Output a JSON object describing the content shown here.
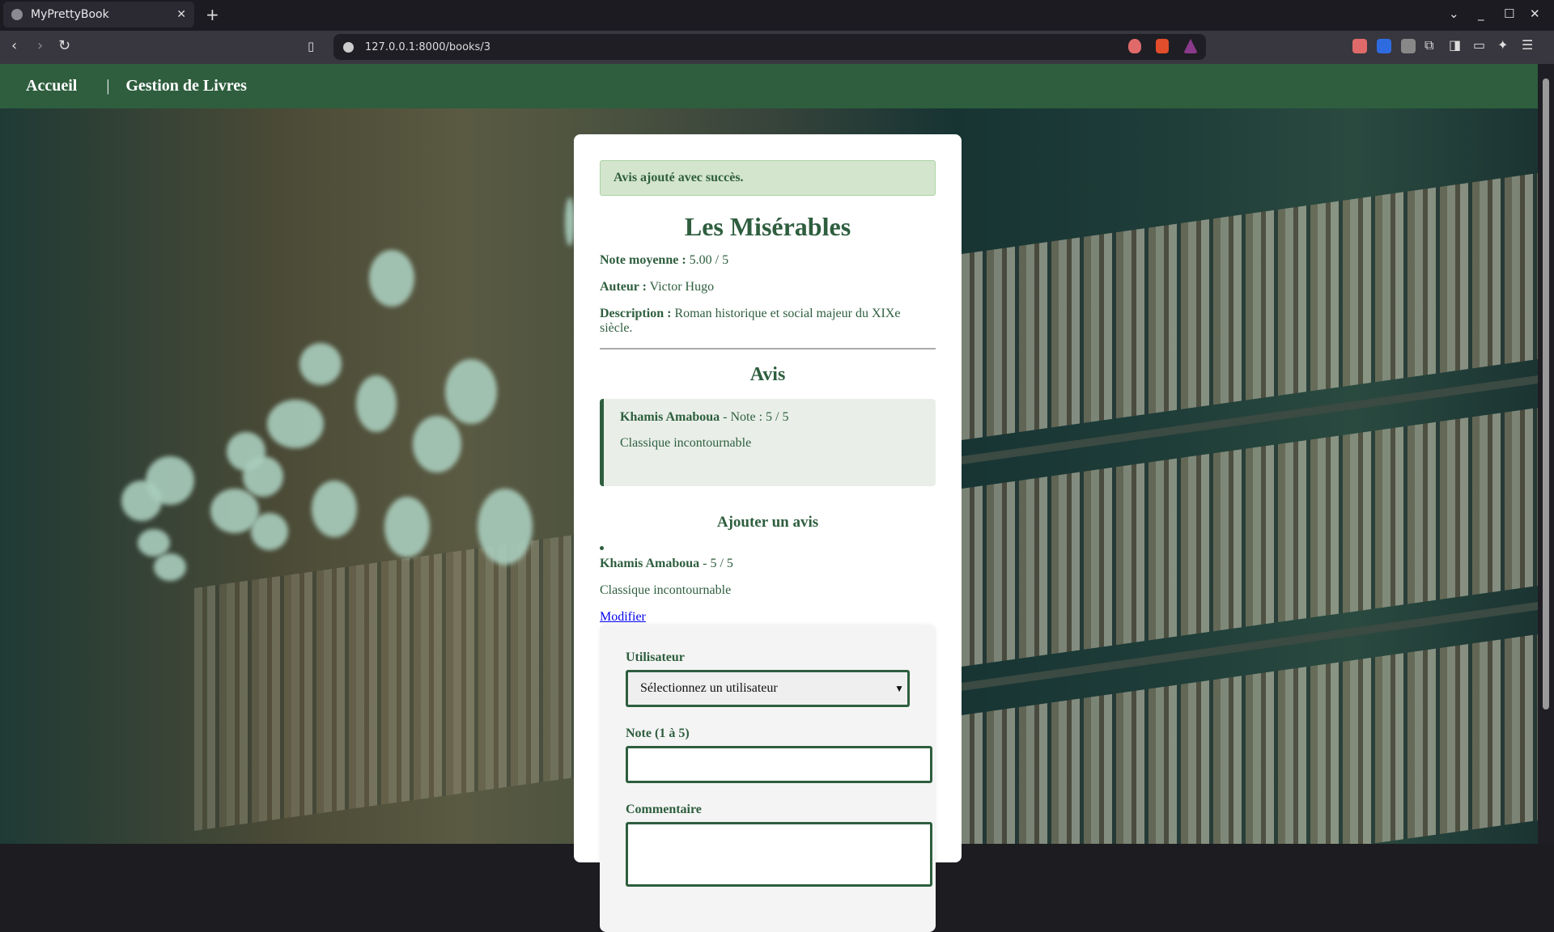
{
  "browser": {
    "tab_title": "MyPrettyBook",
    "url": "127.0.0.1:8000/books/3"
  },
  "nav": {
    "home": "Accueil",
    "separator": "|",
    "manage": "Gestion de Livres"
  },
  "alert": "Avis ajouté avec succès.",
  "book": {
    "title": "Les Misérables",
    "rating_label": "Note moyenne :",
    "rating": "5.00 / 5",
    "author_label": "Auteur :",
    "author": "Victor Hugo",
    "description_label": "Description :",
    "description": "Roman historique et social majeur du XIXe siècle."
  },
  "reviews_heading": "Avis",
  "reviews": [
    {
      "user": "Khamis Amaboua",
      "rating": "- Note : 5 / 5",
      "comment": "Classique incontournable"
    }
  ],
  "add_review": {
    "heading": "Ajouter un avis",
    "my_review": {
      "user": "Khamis Amaboua",
      "rating": "- 5 / 5",
      "comment": "Classique incontournable",
      "edit_link": "Modifier"
    },
    "user_label": "Utilisateur",
    "user_select_value": "Sélectionnez un utilisateur",
    "rating_label": "Note (1 à 5)",
    "rating_value": "",
    "comment_label": "Commentaire",
    "comment_value": ""
  },
  "colors": {
    "primary": "#2e5e3e",
    "alert_bg": "#d4e5cd",
    "review_bg": "#e9efe8"
  }
}
